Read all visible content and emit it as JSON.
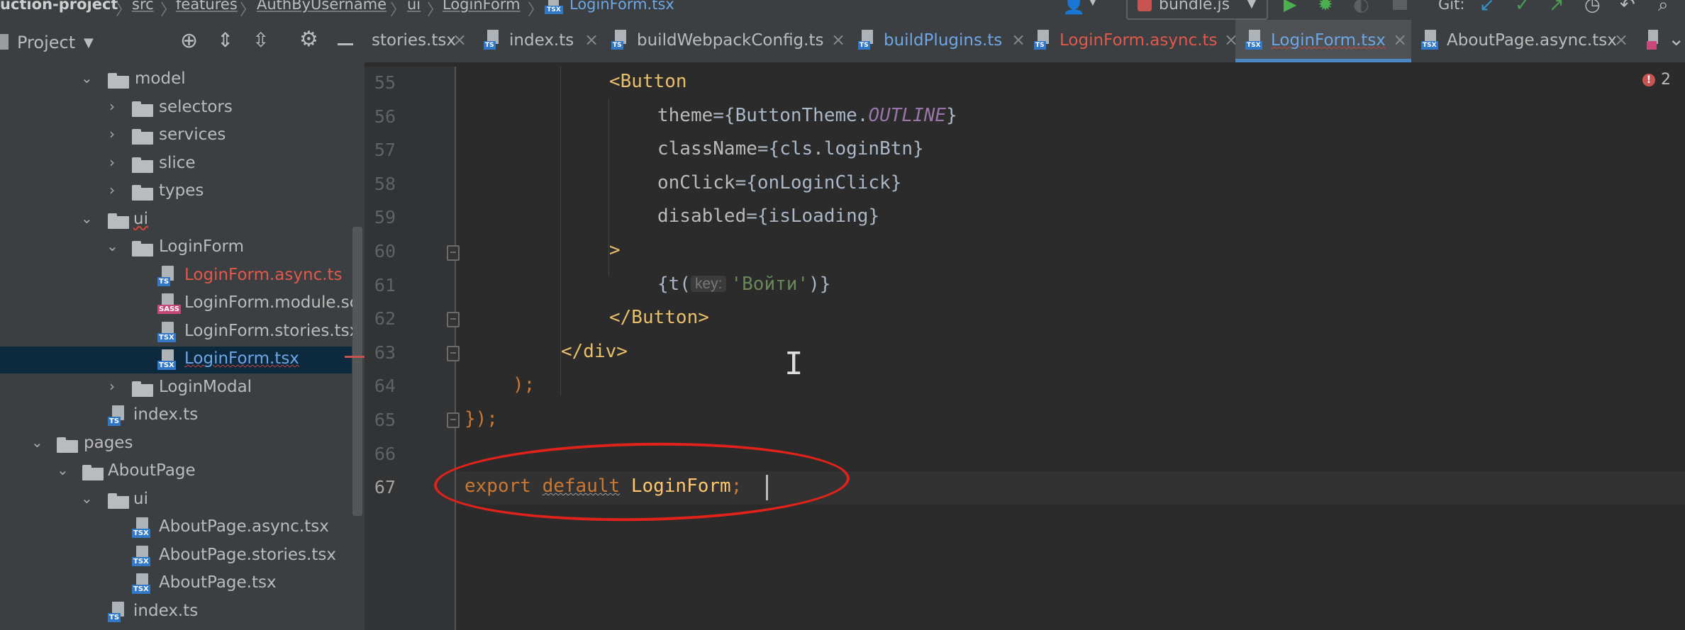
{
  "breadcrumb": [
    {
      "label": "uction-project",
      "style": "bold"
    },
    {
      "label": "src",
      "style": "u"
    },
    {
      "label": "features",
      "style": "u"
    },
    {
      "label": "AuthByUsername",
      "style": "u"
    },
    {
      "label": "ui",
      "style": "u"
    },
    {
      "label": "LoginForm",
      "style": "u"
    },
    {
      "label": "LoginForm.tsx",
      "style": "blue"
    }
  ],
  "toolbar": {
    "run_config": "bundle.js",
    "git_label": "Git:",
    "colors": {
      "run": "#4caf50",
      "git_blue": "#3592c4",
      "git_green": "#499c54"
    }
  },
  "project_panel": {
    "title": "Project",
    "icons": [
      "crosshair-icon",
      "expand-all-icon",
      "collapse-all-icon",
      "gear-icon",
      "minimize-icon"
    ]
  },
  "tree": [
    {
      "label": "model",
      "kind": "folder",
      "expanded": true
    },
    {
      "label": "selectors",
      "kind": "folder",
      "expanded": false
    },
    {
      "label": "services",
      "kind": "folder",
      "expanded": false
    },
    {
      "label": "slice",
      "kind": "folder",
      "expanded": false
    },
    {
      "label": "types",
      "kind": "folder",
      "expanded": false
    },
    {
      "label": "ui",
      "kind": "folder",
      "expanded": true
    },
    {
      "label": "LoginForm",
      "kind": "folder",
      "expanded": true
    },
    {
      "label": "LoginForm.async.ts",
      "kind": "ts-file",
      "color": "red"
    },
    {
      "label": "LoginForm.module.sc",
      "kind": "sass-file"
    },
    {
      "label": "LoginForm.stories.tsx",
      "kind": "tsx-file"
    },
    {
      "label": "LoginForm.tsx",
      "kind": "tsx-file",
      "color": "blue",
      "selected": true
    },
    {
      "label": "LoginModal",
      "kind": "folder",
      "expanded": false
    },
    {
      "label": "index.ts",
      "kind": "ts-file"
    },
    {
      "label": "pages",
      "kind": "folder",
      "expanded": true
    },
    {
      "label": "AboutPage",
      "kind": "folder",
      "expanded": true
    },
    {
      "label": "ui",
      "kind": "folder",
      "expanded": true
    },
    {
      "label": "AboutPage.async.tsx",
      "kind": "tsx-file"
    },
    {
      "label": "AboutPage.stories.tsx",
      "kind": "tsx-file"
    },
    {
      "label": "AboutPage.tsx",
      "kind": "tsx-file"
    },
    {
      "label": "index.ts",
      "kind": "ts-file"
    }
  ],
  "tabs": [
    {
      "label": "stories.tsx",
      "color": "normal",
      "icon": "none"
    },
    {
      "label": "index.ts",
      "color": "normal",
      "icon": "ts"
    },
    {
      "label": "buildWebpackConfig.ts",
      "color": "normal",
      "icon": "ts"
    },
    {
      "label": "buildPlugins.ts",
      "color": "blue",
      "icon": "ts"
    },
    {
      "label": "LoginForm.async.ts",
      "color": "red",
      "icon": "ts"
    },
    {
      "label": "LoginForm.tsx",
      "color": "sel",
      "icon": "tsx",
      "active": true
    },
    {
      "label": "AboutPage.async.tsx",
      "color": "normal",
      "icon": "tsx"
    }
  ],
  "editor": {
    "error_count": "2",
    "line_numbers": [
      "55",
      "56",
      "57",
      "58",
      "59",
      "60",
      "61",
      "62",
      "63",
      "64",
      "65",
      "66",
      "67"
    ],
    "current_line": "67",
    "code": {
      "l55": {
        "tag": "<Button"
      },
      "l56": {
        "attr": "theme",
        "eq": "={",
        "obj": "ButtonTheme.",
        "prop": "OUTLINE",
        "close": "}"
      },
      "l57": {
        "attr": "className",
        "eq": "={",
        "val": "cls.loginBtn",
        "close": "}"
      },
      "l58": {
        "attr": "onClick",
        "eq": "={",
        "val": "onLoginClick",
        "close": "}"
      },
      "l59": {
        "attr": "disabled",
        "eq": "={",
        "val": "isLoading",
        "close": "}"
      },
      "l60": {
        "tag": ">"
      },
      "l61": {
        "open": "{t(",
        "hint": "key:",
        "str": "'Войти'",
        "close": ")}"
      },
      "l62": {
        "tag": "</Button>"
      },
      "l63": {
        "tag": "</div>"
      },
      "l64": {
        "text": ");"
      },
      "l65": {
        "text": "});"
      },
      "l67": {
        "kw1": "export",
        "kw2": "default",
        "ident": "LoginForm",
        "semi": ";"
      }
    }
  }
}
